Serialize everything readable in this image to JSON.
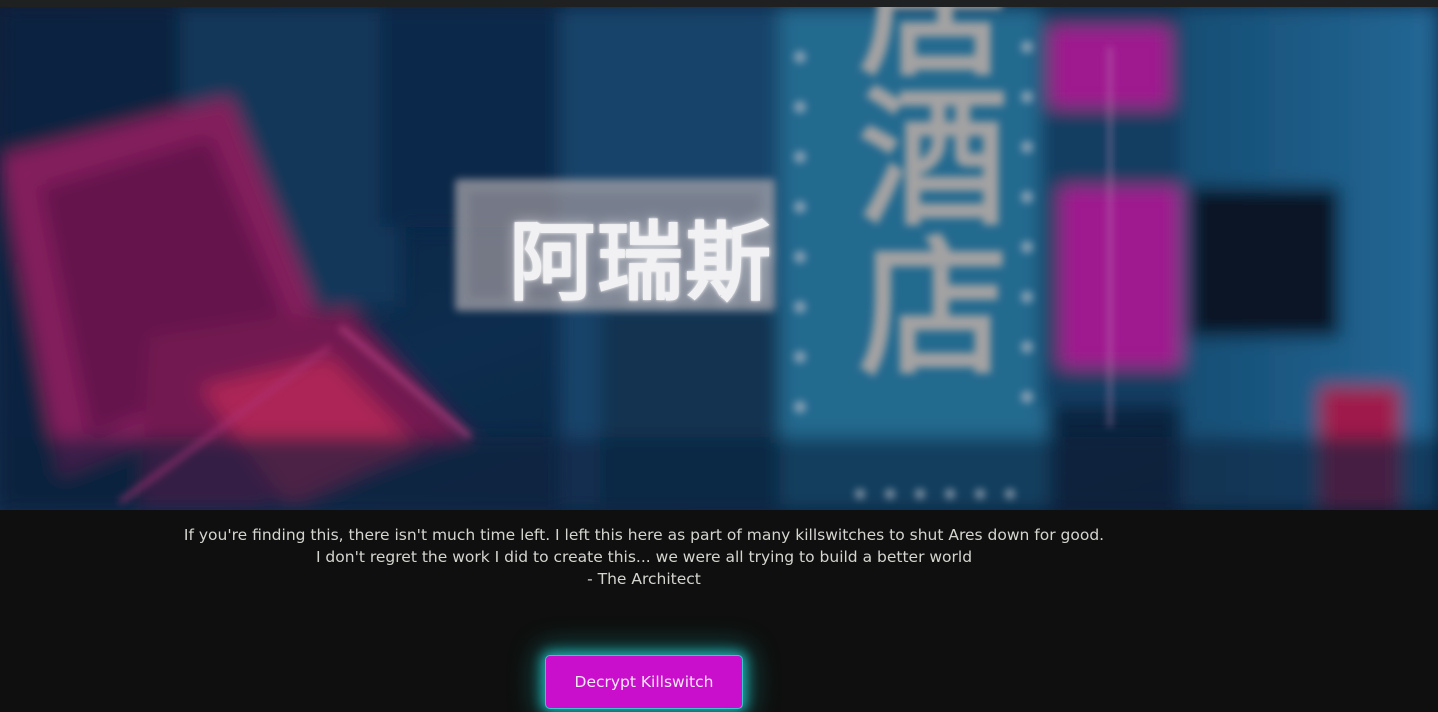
{
  "hero": {
    "title": "阿瑞斯",
    "sign_text": "勿居酒店"
  },
  "message": {
    "line1": "If you're finding this, there isn't much time left. I left this here as part of many killswitches to shut Ares down for good.",
    "line2": "I don't regret the work I did to create this... we were all trying to build a better world",
    "signature": "- The Architect"
  },
  "actions": {
    "decrypt_label": "Decrypt Killswitch"
  },
  "colors": {
    "background": "#0e0f0e",
    "button": "#c90fcb",
    "button_glow": "#24d6d8",
    "text": "#d5d4cf"
  }
}
